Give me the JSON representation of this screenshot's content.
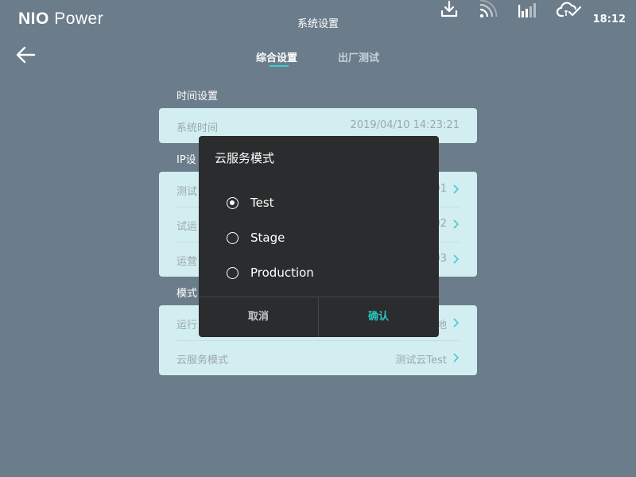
{
  "status_bar": {
    "brand": "NIO",
    "brand_sub": "Power",
    "title": "系统设置",
    "time": "18:12",
    "icons": [
      "download-icon",
      "rss-signal-icon",
      "cellular-signal-icon",
      "cloud-check-icon"
    ]
  },
  "nav": {
    "back_icon": "arrow-left-icon"
  },
  "tabs": [
    {
      "label": "综合设置",
      "active": true
    },
    {
      "label": "出厂测试",
      "active": false
    }
  ],
  "sections": {
    "time": {
      "title": "时间设置",
      "rows": [
        {
          "label": "系统时间",
          "value": "2019/04/10  14:23:21"
        }
      ]
    },
    "ip": {
      "title": "IP设",
      "rows": [
        {
          "label": "测试",
          "value": "01"
        },
        {
          "label": "试运",
          "value": "02"
        },
        {
          "label": "运营",
          "value": "03"
        }
      ]
    },
    "mode": {
      "title": "模式",
      "rows": [
        {
          "label": "运行",
          "value": "地"
        },
        {
          "label": "云服务模式",
          "value": "测试云Test"
        }
      ]
    }
  },
  "dialog": {
    "title": "云服务模式",
    "options": [
      {
        "label": "Test",
        "selected": true
      },
      {
        "label": "Stage",
        "selected": false
      },
      {
        "label": "Production",
        "selected": false
      }
    ],
    "cancel_label": "取消",
    "confirm_label": "确认"
  },
  "colors": {
    "background": "#6b7c8b",
    "card": "#d3eef0",
    "dialog": "#2b2c2d",
    "accent": "#29c6c2"
  }
}
